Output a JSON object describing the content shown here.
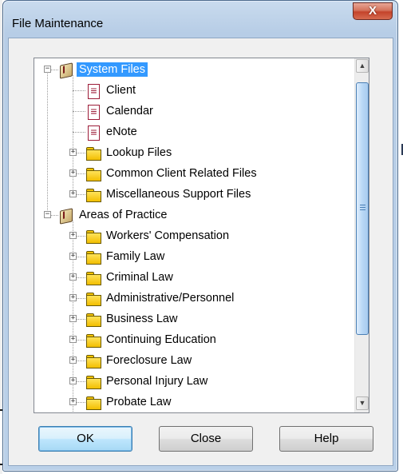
{
  "window": {
    "title": "File Maintenance",
    "close_glyph": "X"
  },
  "tree": {
    "nodes": [
      {
        "label": "System Files",
        "icon": "book-icon",
        "level": 0,
        "expander": "minus",
        "selected": true
      },
      {
        "label": "Client",
        "icon": "file-icon",
        "level": 1,
        "expander": "none",
        "selected": false
      },
      {
        "label": "Calendar",
        "icon": "file-icon",
        "level": 1,
        "expander": "none",
        "selected": false
      },
      {
        "label": "eNote",
        "icon": "file-icon",
        "level": 1,
        "expander": "none",
        "selected": false
      },
      {
        "label": "Lookup Files",
        "icon": "folder-icon",
        "level": 1,
        "expander": "plus",
        "selected": false
      },
      {
        "label": "Common Client Related Files",
        "icon": "folder-icon",
        "level": 1,
        "expander": "plus",
        "selected": false
      },
      {
        "label": "Miscellaneous Support Files",
        "icon": "folder-icon",
        "level": 1,
        "expander": "plus",
        "selected": false
      },
      {
        "label": "Areas of Practice",
        "icon": "book-icon",
        "level": 0,
        "expander": "minus",
        "selected": false
      },
      {
        "label": "Workers' Compensation",
        "icon": "folder-icon",
        "level": 1,
        "expander": "plus",
        "selected": false
      },
      {
        "label": "Family Law",
        "icon": "folder-icon",
        "level": 1,
        "expander": "plus",
        "selected": false
      },
      {
        "label": "Criminal Law",
        "icon": "folder-icon",
        "level": 1,
        "expander": "plus",
        "selected": false
      },
      {
        "label": "Administrative/Personnel",
        "icon": "folder-icon",
        "level": 1,
        "expander": "plus",
        "selected": false
      },
      {
        "label": "Business Law",
        "icon": "folder-icon",
        "level": 1,
        "expander": "plus",
        "selected": false
      },
      {
        "label": "Continuing Education",
        "icon": "folder-icon",
        "level": 1,
        "expander": "plus",
        "selected": false
      },
      {
        "label": "Foreclosure Law",
        "icon": "folder-icon",
        "level": 1,
        "expander": "plus",
        "selected": false
      },
      {
        "label": "Personal Injury Law",
        "icon": "folder-icon",
        "level": 1,
        "expander": "plus",
        "selected": false
      },
      {
        "label": "Probate Law",
        "icon": "folder-icon",
        "level": 1,
        "expander": "plus",
        "selected": false
      }
    ]
  },
  "scrollbar": {
    "up_glyph": "▲",
    "down_glyph": "▼"
  },
  "buttons": {
    "ok": "OK",
    "close": "Close",
    "help": "Help"
  },
  "colors": {
    "selection": "#3399ff",
    "window_frame": "#b9cfe7",
    "close_button": "#c7462f"
  }
}
